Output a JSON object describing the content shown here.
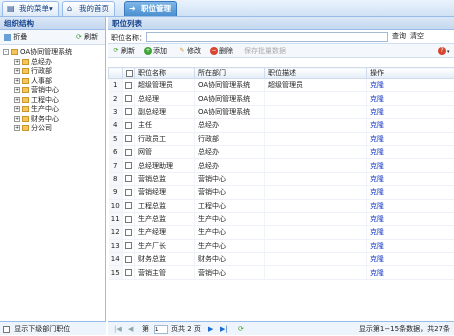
{
  "tabs": [
    {
      "label": "我的菜单",
      "arrow": "▾"
    },
    {
      "label": "我的首页"
    },
    {
      "label": "职位管理"
    }
  ],
  "west": {
    "title": "组织结构",
    "collapse": "折叠",
    "refresh": "刷新",
    "tree": [
      {
        "label": "OA协同管理系统",
        "level": 0,
        "expander": "-"
      },
      {
        "label": "总经办",
        "level": 1,
        "expander": "+"
      },
      {
        "label": "行政部",
        "level": 1,
        "expander": "+"
      },
      {
        "label": "人事部",
        "level": 1,
        "expander": "+"
      },
      {
        "label": "营销中心",
        "level": 1,
        "expander": "+"
      },
      {
        "label": "工程中心",
        "level": 1,
        "expander": "+"
      },
      {
        "label": "生产中心",
        "level": 1,
        "expander": "+"
      },
      {
        "label": "财务中心",
        "level": 1,
        "expander": "+"
      },
      {
        "label": "分公司",
        "level": 1,
        "expander": "+"
      }
    ],
    "footer": "显示下级部门职位"
  },
  "east": {
    "title": "职位列表",
    "search_label": "职位名称：",
    "search_value": "",
    "query": "查询",
    "clear": "清空",
    "toolbar": {
      "refresh": "刷新",
      "add": "添加",
      "edit": "修改",
      "delete": "删除",
      "batch": "保存批量数据"
    },
    "columns": [
      "",
      "职位名称",
      "所在部门",
      "职位描述",
      "操作"
    ],
    "rows": [
      {
        "n": "1",
        "name": "超级管理员",
        "dept": "OA协同管理系统",
        "desc": "超级管理员",
        "op": "克隆"
      },
      {
        "n": "2",
        "name": "总经理",
        "dept": "OA协同管理系统",
        "desc": "",
        "op": "克隆"
      },
      {
        "n": "3",
        "name": "副总经理",
        "dept": "OA协同管理系统",
        "desc": "",
        "op": "克隆"
      },
      {
        "n": "4",
        "name": "主任",
        "dept": "总经办",
        "desc": "",
        "op": "克隆"
      },
      {
        "n": "5",
        "name": "行政员工",
        "dept": "行政部",
        "desc": "",
        "op": "克隆"
      },
      {
        "n": "6",
        "name": "网管",
        "dept": "总经办",
        "desc": "",
        "op": "克隆"
      },
      {
        "n": "7",
        "name": "总经理助理",
        "dept": "总经办",
        "desc": "",
        "op": "克隆"
      },
      {
        "n": "8",
        "name": "营销总监",
        "dept": "营销中心",
        "desc": "",
        "op": "克隆"
      },
      {
        "n": "9",
        "name": "营销经理",
        "dept": "营销中心",
        "desc": "",
        "op": "克隆"
      },
      {
        "n": "10",
        "name": "工程总监",
        "dept": "工程中心",
        "desc": "",
        "op": "克隆"
      },
      {
        "n": "11",
        "name": "生产总监",
        "dept": "生产中心",
        "desc": "",
        "op": "克隆"
      },
      {
        "n": "12",
        "name": "生产经理",
        "dept": "生产中心",
        "desc": "",
        "op": "克隆"
      },
      {
        "n": "13",
        "name": "生产厂长",
        "dept": "生产中心",
        "desc": "",
        "op": "克隆"
      },
      {
        "n": "14",
        "name": "财务总监",
        "dept": "财务中心",
        "desc": "",
        "op": "克隆"
      },
      {
        "n": "15",
        "name": "营销主管",
        "dept": "营销中心",
        "desc": "",
        "op": "克隆"
      }
    ],
    "pager": {
      "page_label": "第",
      "page_value": "1",
      "of_label": "页共 2 页",
      "info": "显示第1−15条数据，共27条"
    }
  }
}
